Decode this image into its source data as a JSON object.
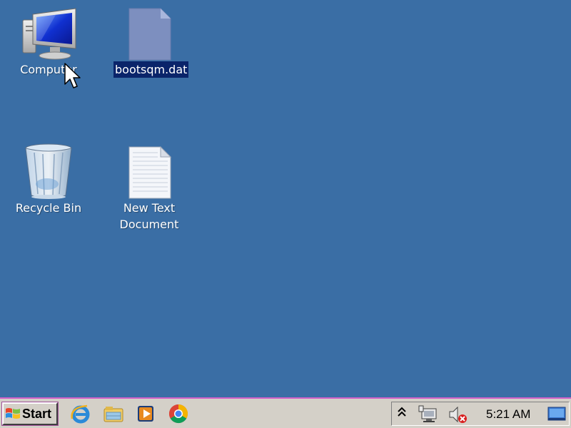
{
  "desktop": {
    "background": "#3a6ea5",
    "icons": [
      {
        "label": "Computer",
        "icon": "computer-icon",
        "selected": false
      },
      {
        "label": "bootsqm.dat",
        "icon": "generic-file-icon",
        "selected": true
      },
      {
        "label": "Recycle Bin",
        "icon": "recycle-bin-icon",
        "selected": false
      },
      {
        "label": "New Text\nDocument",
        "icon": "text-document-icon",
        "selected": false
      }
    ],
    "selection_color": "#0a246a"
  },
  "taskbar": {
    "start_label": "Start",
    "quick_launch": [
      {
        "icon": "internet-explorer-icon"
      },
      {
        "icon": "windows-explorer-icon"
      },
      {
        "icon": "media-player-icon"
      },
      {
        "icon": "chrome-icon"
      }
    ],
    "tray": {
      "clock": "5:21 AM",
      "icons": [
        "show-hidden-icons-chevron",
        "network-icon",
        "volume-muted-icon",
        "show-desktop-icon"
      ]
    },
    "border_color": "#d060c8"
  }
}
